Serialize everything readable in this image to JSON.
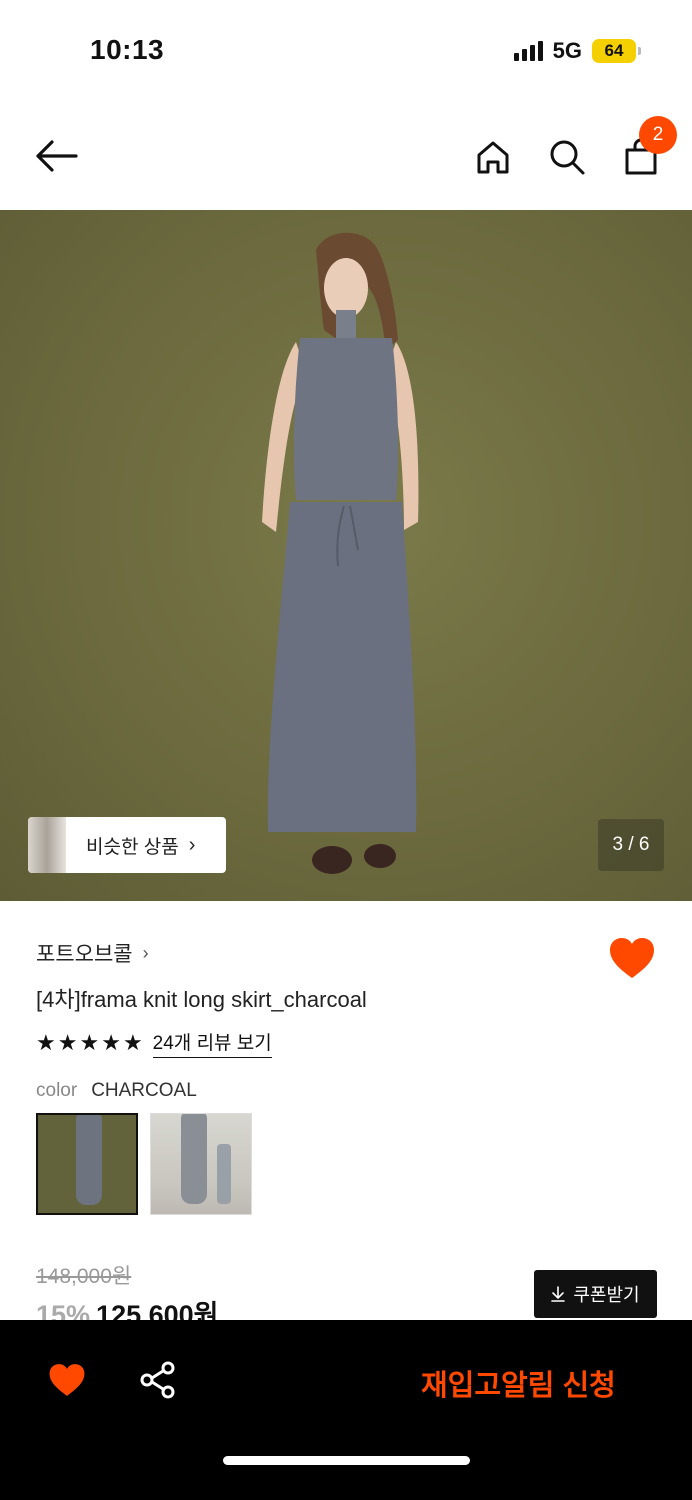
{
  "status_bar": {
    "time": "10:13",
    "network": "5G",
    "battery": "64"
  },
  "header": {
    "back_icon": "arrow-left-icon",
    "home_icon": "home-icon",
    "search_icon": "search-icon",
    "cart_icon": "shopping-bag-icon",
    "cart_count": "2"
  },
  "hero": {
    "similar_label": "비슷한 상품",
    "page_counter": "3 / 6",
    "background_color": "#6c6a3e"
  },
  "product": {
    "brand": "포트오브콜",
    "name": "[4차]frama knit long skirt_charcoal",
    "rating_stars": 5,
    "review_link": "24개 리뷰 보기",
    "color_label": "color",
    "color_value": "CHARCOAL",
    "original_price": "148,000원",
    "discount": "15%",
    "sale_price": "125,600원",
    "coupon_label": "쿠폰받기"
  },
  "bottom_bar": {
    "restock_label": "재입고알림 신청",
    "accent_color": "#ff4800"
  }
}
